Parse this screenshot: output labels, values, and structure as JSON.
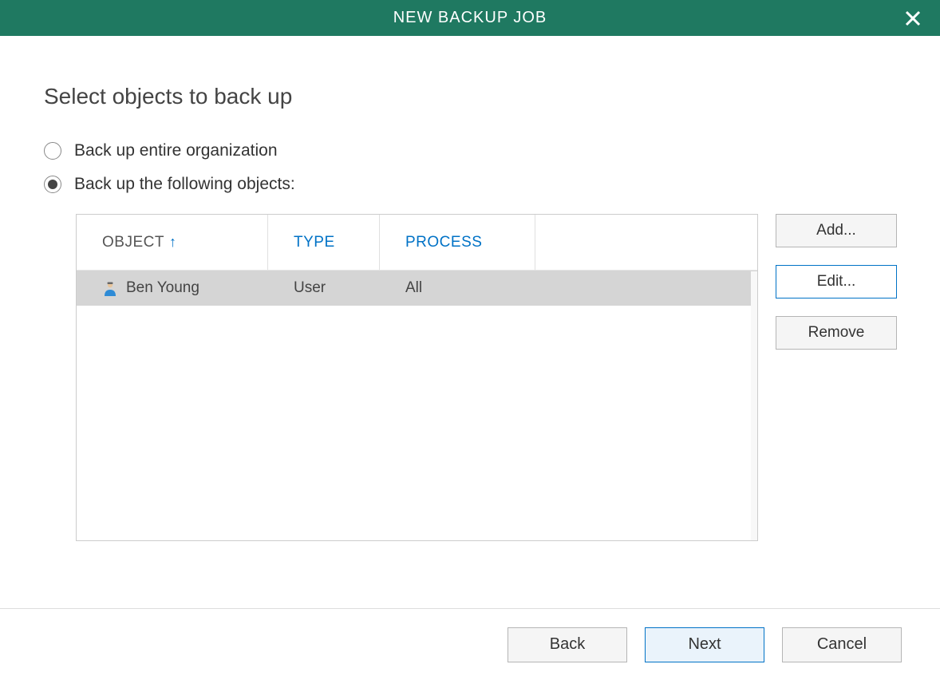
{
  "titlebar": {
    "title": "NEW BACKUP JOB"
  },
  "heading": "Select objects to back up",
  "radios": {
    "entire": "Back up entire organization",
    "following": "Back up the following objects:",
    "selected": "following"
  },
  "table": {
    "headers": {
      "object": "OBJECT",
      "type": "TYPE",
      "process": "PROCESS"
    },
    "sort_indicator": "↑",
    "rows": [
      {
        "object": "Ben Young",
        "type": "User",
        "process": "All"
      }
    ]
  },
  "side_buttons": {
    "add": "Add...",
    "edit": "Edit...",
    "remove": "Remove"
  },
  "footer": {
    "back": "Back",
    "next": "Next",
    "cancel": "Cancel"
  }
}
